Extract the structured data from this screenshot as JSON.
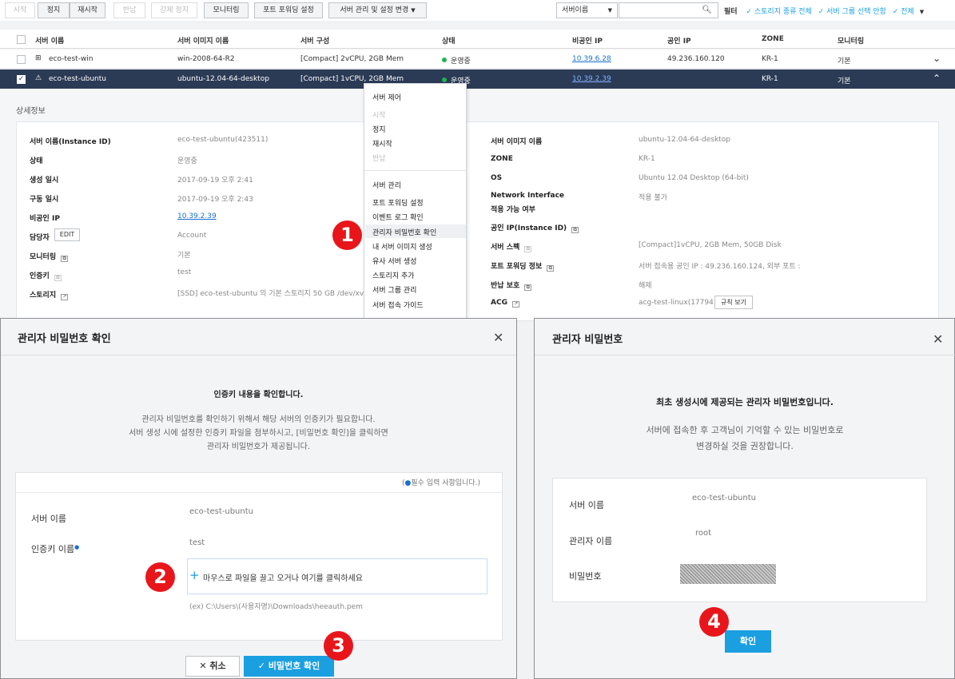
{
  "toolbar": {
    "start": "시작",
    "stop": "정지",
    "restart": "재시작",
    "return": "반납",
    "force_stop": "강제 정지",
    "monitoring": "모니터링",
    "port_forwarding": "포트 포워딩 설정",
    "manage": "서버 관리 및 설정 변경",
    "search_select": "서버이름",
    "filter_label": "필터",
    "filter_storage": "스토리지 종류 전체",
    "filter_group": "서버 그룹 선택 안함",
    "filter_all": "전체"
  },
  "table": {
    "headers": [
      "서버 이름",
      "서버 이미지 이름",
      "서버 구성",
      "상태",
      "비공인 IP",
      "공인 IP",
      "ZONE",
      "모니터링"
    ],
    "rows": [
      {
        "name": "eco-test-win",
        "image": "win-2008-64-R2",
        "spec": "[Compact] 2vCPU, 2GB Mem",
        "status": "운영중",
        "private_ip": "10.39.6.28",
        "public_ip": "49.236.160.120",
        "zone": "KR-1",
        "monitoring": "기본"
      },
      {
        "name": "eco-test-ubuntu",
        "image": "ubuntu-12.04-64-desktop",
        "spec": "[Compact] 1vCPU, 2GB Mem",
        "status": "운영중",
        "private_ip": "10.39.2.39",
        "public_ip": "",
        "zone": "KR-1",
        "monitoring": "기본"
      }
    ]
  },
  "details": {
    "title": "상세정보",
    "left": [
      {
        "label": "서버 이름(Instance ID)",
        "value": "eco-test-ubuntu(423511)"
      },
      {
        "label": "상태",
        "value": "운영중"
      },
      {
        "label": "생성 일시",
        "value": "2017-09-19 오후 2:41"
      },
      {
        "label": "구동 일시",
        "value": "2017-09-19 오후 2:43"
      },
      {
        "label": "비공인 IP",
        "value": "10.39.2.39"
      },
      {
        "label": "담당자",
        "value": "Account",
        "btn": "EDIT"
      },
      {
        "label": "모니터링",
        "value": "기본"
      },
      {
        "label": "인증키",
        "value": "test"
      },
      {
        "label": "스토리지",
        "value": "[SSD] eco-test-ubuntu 의 기본 스토리지 50 GB /dev/xvda"
      }
    ],
    "right": [
      {
        "label": "서버 이미지 이름",
        "value": "ubuntu-12.04-64-desktop"
      },
      {
        "label": "ZONE",
        "value": "KR-1"
      },
      {
        "label": "OS",
        "value": "Ubuntu 12.04 Desktop (64-bit)"
      },
      {
        "label": "Network Interface",
        "label2": "적용 가능 여부",
        "value": "적용 불가"
      },
      {
        "label": "공인 IP(Instance ID)",
        "value": ""
      },
      {
        "label": "서버 스펙",
        "value": "[Compact]1vCPU, 2GB Mem, 50GB Disk"
      },
      {
        "label": "포트 포워딩 정보",
        "value": "서버 접속용 공인 IP : 49.236.160.124, 외부 포트 :"
      },
      {
        "label": "반납 보호",
        "value": "해제"
      },
      {
        "label": "ACG",
        "value": "acg-test-linux(17794)",
        "btn": "규칙 보기"
      }
    ]
  },
  "context_menu": {
    "section1": "서버 제어",
    "start": "시작",
    "stop": "정지",
    "restart": "재시작",
    "return": "반납",
    "section2": "서버 관리",
    "items": [
      "포트 포워딩 설정",
      "이벤트 로그 확인",
      "관리자 비밀번호 확인",
      "내 서버 이미지 생성",
      "유사 서버 생성",
      "스토리지 추가",
      "서버 그룹 관리",
      "서버 접속 가이드"
    ]
  },
  "modal_confirm": {
    "title": "관리자 비밀번호 확인",
    "heading": "인증키 내용을 확인합니다.",
    "desc1": "관리자 비밀번호를 확인하기 위해서 해당 서버의 인증키가 필요합니다.",
    "desc2": "서버 생성 시에 설정한 인증키 파일을 첨부하시고, [비밀번호 확인]을 클릭하면",
    "desc3": "관리자 비밀번호가 제공됩니다.",
    "required": "필수 입력 사항입니다.",
    "server_label": "서버 이름",
    "server_value": "eco-test-ubuntu",
    "key_label": "인증키 이름",
    "key_value": "test",
    "drop_text": "마우스로 파일을 끌고 오거나 여기를 클릭하세요",
    "example": "(ex) C:\\Users\\(사용자명)\\Downloads\\heeauth.pem",
    "cancel": "취소",
    "confirm": "비밀번호 확인"
  },
  "modal_password": {
    "title": "관리자 비밀번호",
    "heading": "최초 생성시에 제공되는 관리자 비밀번호입니다.",
    "desc1": "서버에 접속한 후 고객님이 기억할 수 있는 비밀번호로",
    "desc2": "변경하실 것을 권장합니다.",
    "server_label": "서버 이름",
    "server_value": "eco-test-ubuntu",
    "admin_label": "관리자 이름",
    "admin_value": "root",
    "pw_label": "비밀번호",
    "ok": "확인"
  },
  "steps": [
    "1",
    "2",
    "3",
    "4"
  ],
  "colors": {
    "accent": "#1a9fe0",
    "selected_row": "#2b3a55",
    "badge": "#e8161a",
    "running": "#1fb34f"
  }
}
